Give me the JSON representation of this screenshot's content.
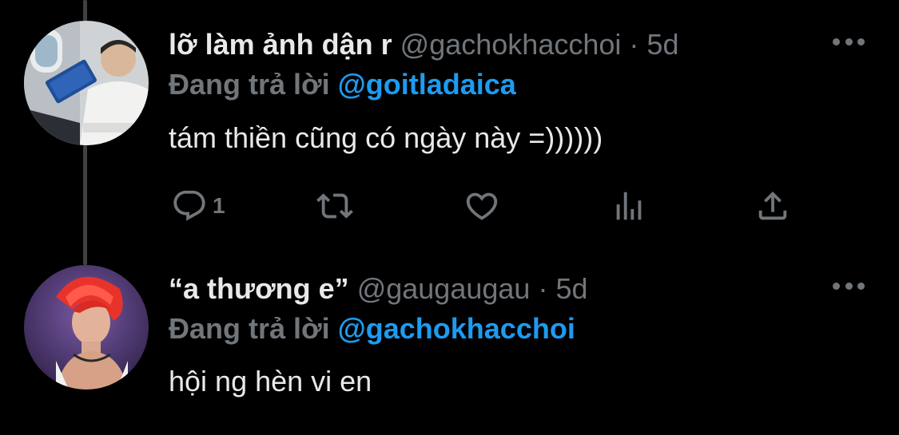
{
  "colors": {
    "background": "#000000",
    "text_primary": "#e7e9ea",
    "text_secondary": "#71767b",
    "mention_blue": "#1d9bf0",
    "thread_line": "#3e4144"
  },
  "tweets": [
    {
      "display_name": "lỡ làm ảnh dận r",
      "handle": "@gachokhacchoi",
      "separator": "·",
      "time": "5d",
      "reply_prefix": "Đang trả lời",
      "reply_to": "@goitladaica",
      "text": "tám thiền cũng có ngày này =))))))",
      "avatar_icon": "avatar-photo-reading",
      "more_icon": "more-dots-icon",
      "actions": {
        "reply_count": "1",
        "reply_icon": "reply-icon",
        "retweet_icon": "retweet-icon",
        "like_icon": "heart-icon",
        "analytics_icon": "analytics-icon",
        "share_icon": "share-icon"
      }
    },
    {
      "display_name": "“a thương e”",
      "handle": "@gaugaugau",
      "separator": "·",
      "time": "5d",
      "reply_prefix": "Đang trả lời",
      "reply_to": "@gachokhacchoi",
      "text": "hội ng hèn vi en",
      "avatar_icon": "avatar-photo-red-hair",
      "more_icon": "more-dots-icon"
    }
  ]
}
